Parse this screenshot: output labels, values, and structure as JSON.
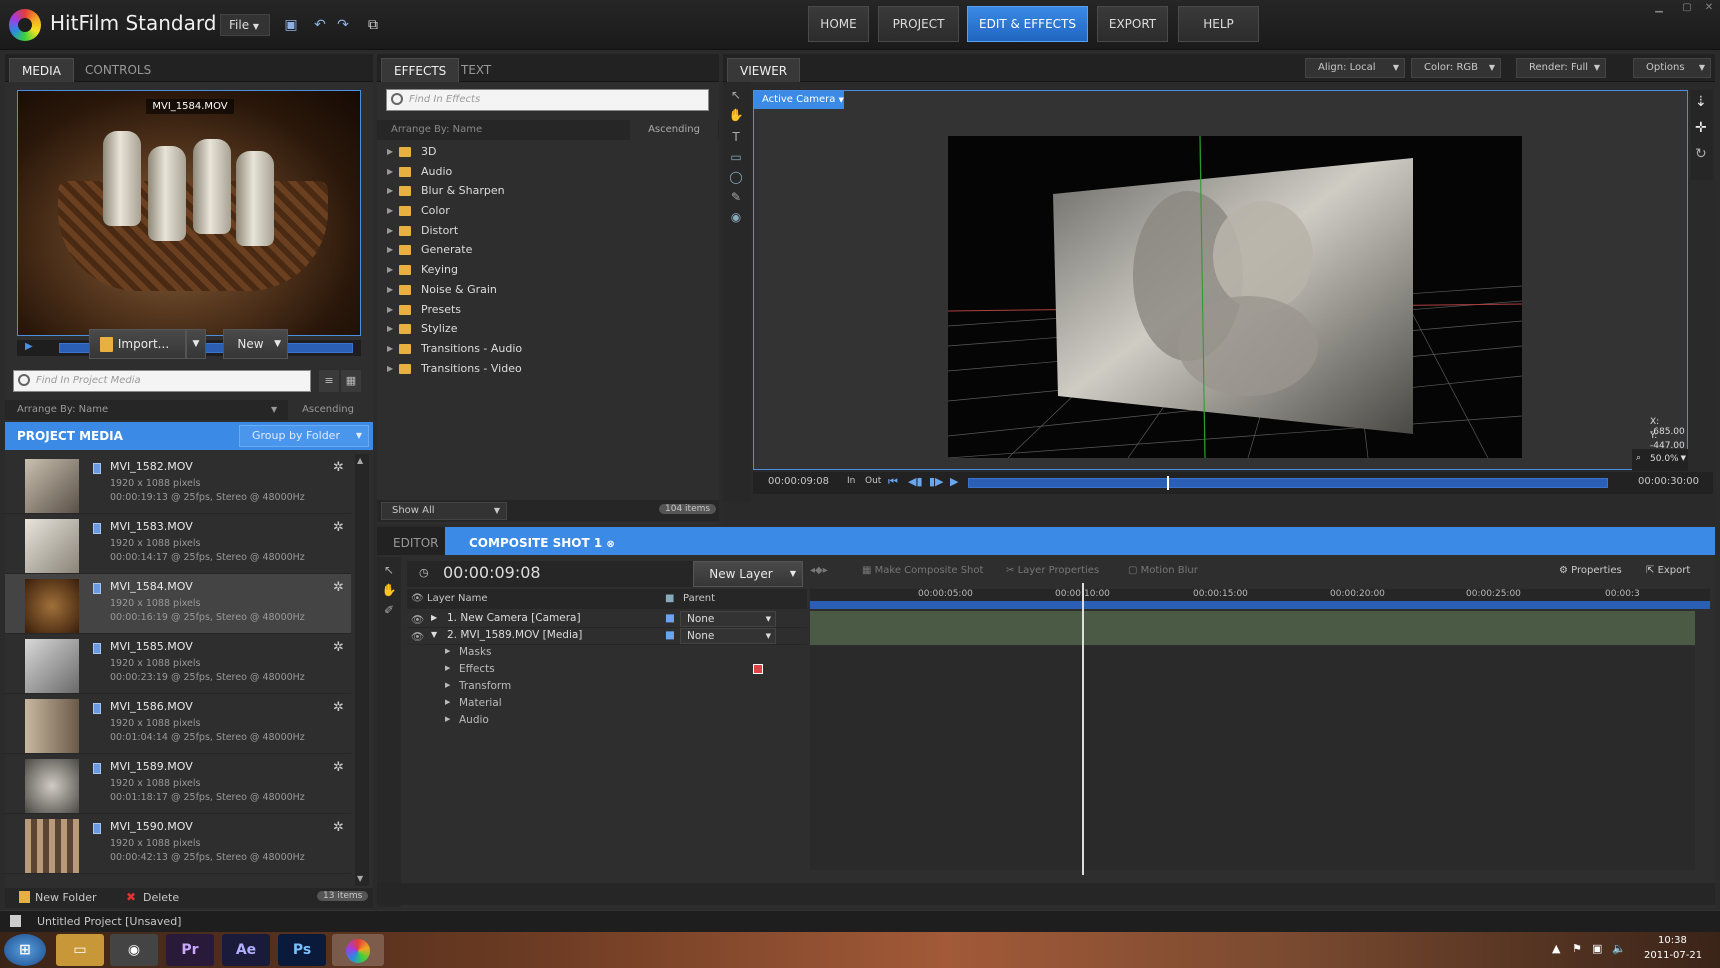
{
  "app": {
    "name": "HitFilm Standard",
    "file_menu": "File"
  },
  "nav": {
    "items": [
      "HOME",
      "PROJECT",
      "EDIT & EFFECTS",
      "EXPORT",
      "HELP"
    ],
    "active": "EDIT & EFFECTS"
  },
  "media_panel": {
    "tabs": [
      "MEDIA",
      "CONTROLS"
    ],
    "preview_label": "MVI_1584.MOV",
    "import_label": "Import...",
    "new_label": "New",
    "search_placeholder": "Find In Project Media",
    "arrange_label": "Arrange By: Name",
    "arrange_order": "Ascending",
    "project_media_label": "PROJECT MEDIA",
    "group_label": "Group by Folder",
    "items": [
      {
        "name": "MVI_1582.MOV",
        "res": "1920 x 1088 pixels",
        "info": "00:00:19:13 @ 25fps, Stereo @ 48000Hz"
      },
      {
        "name": "MVI_1583.MOV",
        "res": "1920 x 1088 pixels",
        "info": "00:00:14:17 @ 25fps, Stereo @ 48000Hz"
      },
      {
        "name": "MVI_1584.MOV",
        "res": "1920 x 1088 pixels",
        "info": "00:00:16:19 @ 25fps, Stereo @ 48000Hz"
      },
      {
        "name": "MVI_1585.MOV",
        "res": "1920 x 1088 pixels",
        "info": "00:00:23:19 @ 25fps, Stereo @ 48000Hz"
      },
      {
        "name": "MVI_1586.MOV",
        "res": "1920 x 1088 pixels",
        "info": "00:01:04:14 @ 25fps, Stereo @ 48000Hz"
      },
      {
        "name": "MVI_1589.MOV",
        "res": "1920 x 1088 pixels",
        "info": "00:01:18:17 @ 25fps, Stereo @ 48000Hz"
      },
      {
        "name": "MVI_1590.MOV",
        "res": "1920 x 1088 pixels",
        "info": "00:00:42:13 @ 25fps, Stereo @ 48000Hz"
      }
    ],
    "new_folder_label": "New Folder",
    "delete_label": "Delete",
    "item_count": "13 items"
  },
  "effects_panel": {
    "tabs": [
      "EFFECTS",
      "TEXT"
    ],
    "search_placeholder": "Find In Effects",
    "arrange_label": "Arrange By: Name",
    "arrange_order": "Ascending",
    "categories": [
      "3D",
      "Audio",
      "Blur & Sharpen",
      "Color",
      "Distort",
      "Generate",
      "Keying",
      "Noise & Grain",
      "Presets",
      "Stylize",
      "Transitions - Audio",
      "Transitions - Video"
    ],
    "show_label": "Show All",
    "item_count": "104 items"
  },
  "viewer": {
    "tab": "VIEWER",
    "align": "Align: Local",
    "color": "Color: RGB",
    "render": "Render: Full",
    "options": "Options",
    "camera": "Active Camera",
    "coord_x": "X:   -685.00",
    "coord_y": "Y:   -447.00",
    "zoom": "50.0%",
    "current_time": "00:00:09:08",
    "in_label": "In",
    "out_label": "Out",
    "end_time": "00:00:30:00",
    "playhead_progress": 0.31
  },
  "timeline": {
    "tabs": [
      "EDITOR",
      "COMPOSITE SHOT 1"
    ],
    "timecode": "00:00:09:08",
    "new_layer": "New Layer",
    "make_composite": "Make Composite Shot",
    "layer_properties": "Layer Properties",
    "motion_blur": "Motion Blur",
    "properties": "Properties",
    "export": "Export",
    "col_layer_name": "Layer Name",
    "col_parent": "Parent",
    "layers": [
      {
        "name": "1. New Camera [Camera]",
        "parent": "None"
      },
      {
        "name": "2. MVI_1589.MOV [Media]",
        "parent": "None"
      }
    ],
    "sub_props": [
      "Masks",
      "Effects",
      "Transform",
      "Material",
      "Audio"
    ],
    "ruler": [
      "00:00:05:00",
      "00:00:10:00",
      "00:00:15:00",
      "00:00:20:00",
      "00:00:25:00",
      "00:00:3"
    ]
  },
  "status": {
    "project": "Untitled Project  [Unsaved]"
  },
  "taskbar": {
    "time": "10:38",
    "date": "2011-07-21",
    "apps": [
      "Pr",
      "Ae",
      "Ps"
    ]
  },
  "colors": {
    "accent": "#3a8ae6",
    "panel": "#2e2e2e",
    "folder": "#e8b040"
  }
}
